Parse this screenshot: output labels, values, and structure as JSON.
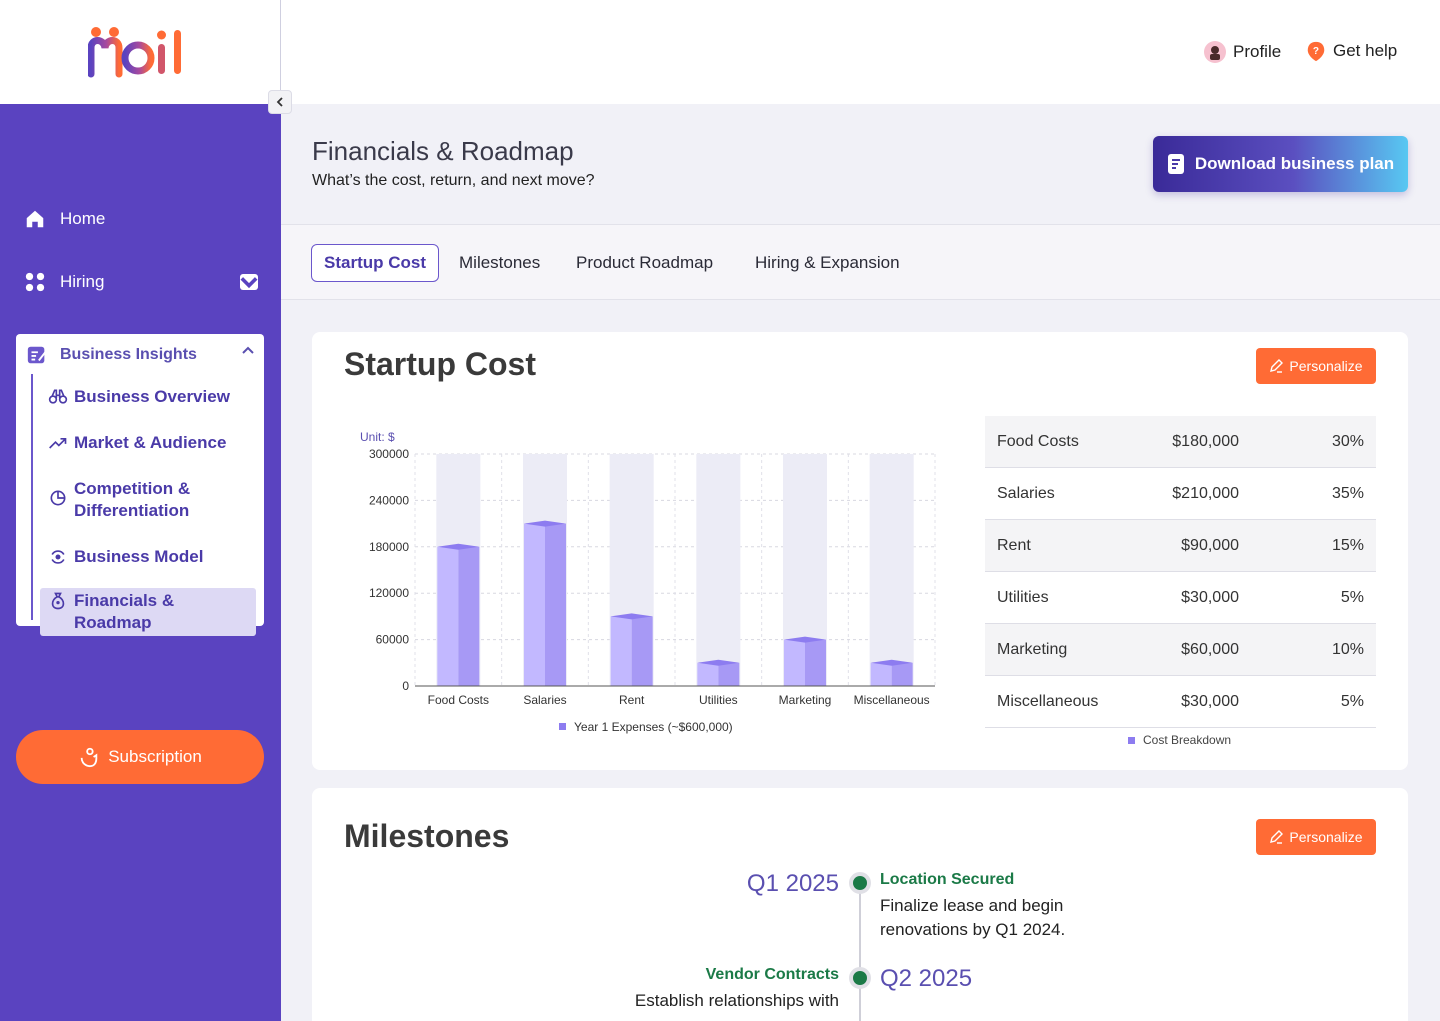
{
  "app": {
    "logo_text": "Moil"
  },
  "topbar": {
    "profile_label": "Profile",
    "help_label": "Get help"
  },
  "sidebar": {
    "home_label": "Home",
    "hiring_label": "Hiring",
    "insights": {
      "title": "Business Insights",
      "items": [
        {
          "label": "Business Overview"
        },
        {
          "label": "Market & Audience"
        },
        {
          "label": "Competition & Differentiation"
        },
        {
          "label": "Business Model"
        },
        {
          "label": "Financials & Roadmap"
        }
      ]
    },
    "subscription_label": "Subscription"
  },
  "header": {
    "title": "Financials & Roadmap",
    "subtitle": "What’s the cost, return, and next move?",
    "download_label": "Download business plan"
  },
  "tabs": [
    {
      "label": "Startup Cost"
    },
    {
      "label": "Milestones"
    },
    {
      "label": "Product Roadmap"
    },
    {
      "label": "Hiring & Expansion"
    }
  ],
  "startup_cost": {
    "title": "Startup Cost",
    "personalize_label": "Personalize",
    "table": [
      {
        "name": "Food Costs",
        "amount": "$180,000",
        "pct": "30%"
      },
      {
        "name": "Salaries",
        "amount": "$210,000",
        "pct": "35%"
      },
      {
        "name": "Rent",
        "amount": "$90,000",
        "pct": "15%"
      },
      {
        "name": "Utilities",
        "amount": "$30,000",
        "pct": "5%"
      },
      {
        "name": "Marketing",
        "amount": "$60,000",
        "pct": "10%"
      },
      {
        "name": "Miscellaneous",
        "amount": "$30,000",
        "pct": "5%"
      }
    ],
    "table_legend": "Cost Breakdown"
  },
  "chart_data": {
    "type": "bar",
    "unit_label": "Unit: $",
    "categories": [
      "Food Costs",
      "Salaries",
      "Rent",
      "Utilities",
      "Marketing",
      "Miscellaneous"
    ],
    "series": [
      {
        "name": "Year 1 Expenses (~$600,000)",
        "values": [
          180000,
          210000,
          90000,
          30000,
          60000,
          30000
        ]
      }
    ],
    "y_ticks": [
      "300000",
      "240000",
      "180000",
      "120000",
      "60000",
      "0"
    ],
    "ylim": [
      0,
      300000
    ],
    "grid": true,
    "legend_position": "bottom",
    "colors": {
      "bar_front": "#c2b8ff",
      "bar_side": "#a799f5",
      "bar_top": "#8d7cf0",
      "shade": "#ececf6"
    }
  },
  "milestones": {
    "title": "Milestones",
    "personalize_label": "Personalize",
    "items": [
      {
        "quarter": "Q1 2025",
        "heading": "Location Secured",
        "desc_line1": "Finalize lease and begin",
        "desc_line2": "renovations by Q1 2024."
      },
      {
        "quarter": "Q2 2025",
        "heading": "Vendor Contracts",
        "desc_line1": "Establish relationships with"
      }
    ]
  }
}
